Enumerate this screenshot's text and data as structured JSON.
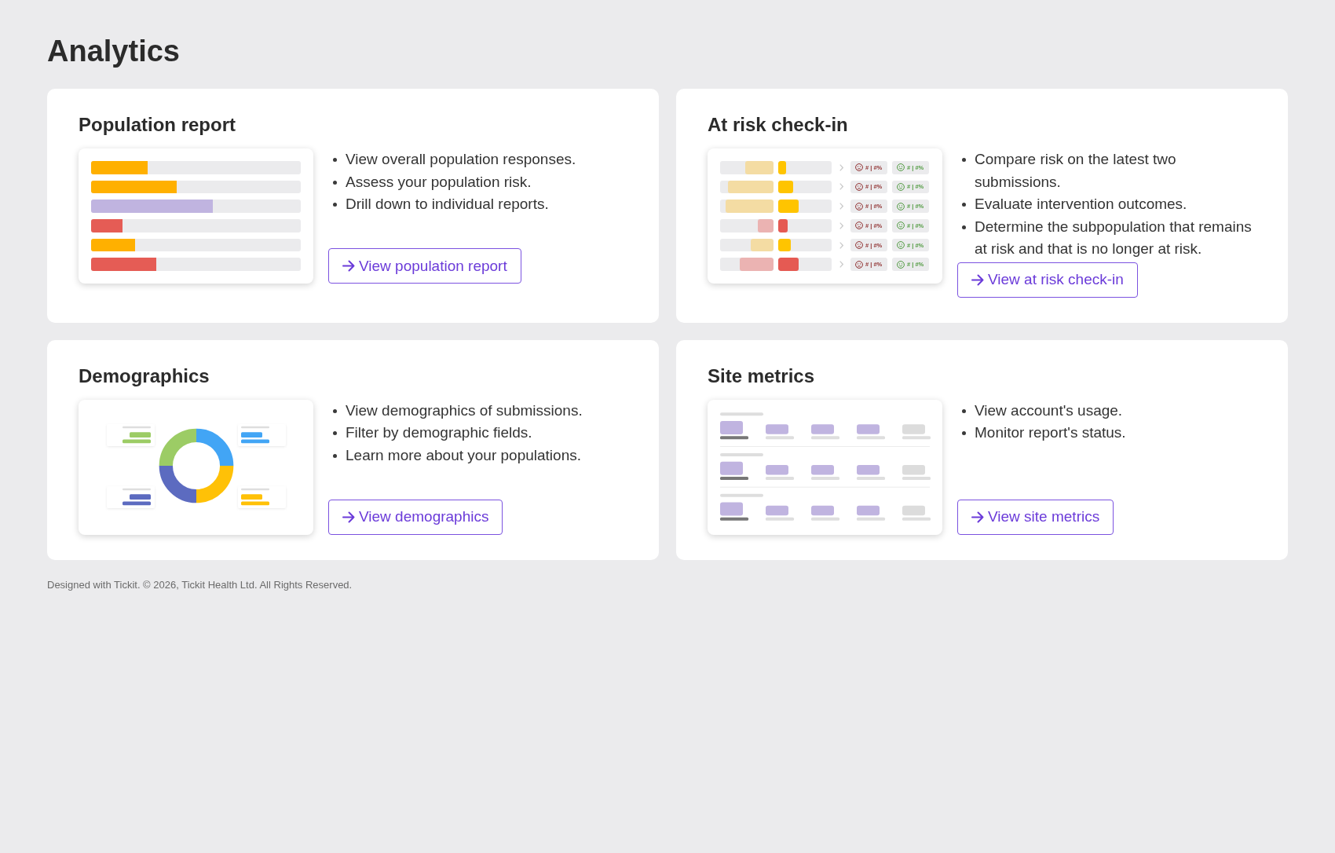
{
  "page_title": "Analytics",
  "cards": [
    {
      "title": "Population report",
      "preview": {
        "kind": "bars",
        "bars": [
          {
            "level": 0.27,
            "color": "#ffb000"
          },
          {
            "level": 0.41,
            "color": "#ffb000"
          },
          {
            "level": 0.58,
            "color": "#c0b4e0"
          },
          {
            "level": 0.15,
            "color": "#e55c55"
          },
          {
            "level": 0.21,
            "color": "#ffb000"
          },
          {
            "level": 0.31,
            "color": "#e55c55"
          }
        ]
      },
      "bullets": [
        "View overall population responses.",
        "Assess your population risk.",
        "Drill down to individual reports."
      ],
      "button": {
        "label": "View population report"
      }
    },
    {
      "title": "At risk check-in",
      "preview": {
        "kind": "risk_rows",
        "rows": [
          {
            "left_bar": {
              "level": 0.53,
              "color": "#f4dca3"
            },
            "right_bar": {
              "level": 0.14,
              "color": "#ffc400"
            },
            "tags": [
              {
                "kind": "sad",
                "text": "# | #%"
              },
              {
                "kind": "happy",
                "text": "# | #%"
              }
            ]
          },
          {
            "left_bar": {
              "level": 0.85,
              "color": "#f4dca3"
            },
            "right_bar": {
              "level": 0.28,
              "color": "#ffc400"
            },
            "tags": [
              {
                "kind": "sad",
                "text": "# | #%"
              },
              {
                "kind": "happy",
                "text": "# | #%"
              }
            ]
          },
          {
            "left_bar": {
              "level": 0.9,
              "color": "#f4dca3"
            },
            "right_bar": {
              "level": 0.38,
              "color": "#ffc400"
            },
            "tags": [
              {
                "kind": "sad",
                "text": "# | #%"
              },
              {
                "kind": "happy",
                "text": "# | #%"
              }
            ]
          },
          {
            "left_bar": {
              "level": 0.3,
              "color": "#ebb3b2"
            },
            "right_bar": {
              "level": 0.18,
              "color": "#e55a53"
            },
            "tags": [
              {
                "kind": "sad",
                "text": "# | #%"
              },
              {
                "kind": "happy",
                "text": "# | #%"
              }
            ]
          },
          {
            "left_bar": {
              "level": 0.42,
              "color": "#f4dca3"
            },
            "right_bar": {
              "level": 0.24,
              "color": "#ffc400"
            },
            "tags": [
              {
                "kind": "sad",
                "text": "# | #%"
              },
              {
                "kind": "happy",
                "text": "# | #%"
              }
            ]
          },
          {
            "left_bar": {
              "level": 0.63,
              "color": "#ebb3b2"
            },
            "right_bar": {
              "level": 0.38,
              "color": "#e55a53"
            },
            "tags": [
              {
                "kind": "sad",
                "text": "# | #%"
              },
              {
                "kind": "happy",
                "text": "# | #%"
              }
            ]
          }
        ]
      },
      "bullets": [
        "Compare risk on the latest two submissions.",
        "Evaluate intervention outcomes.",
        "Determine the subpopulation that remains at risk and that is no longer at risk."
      ],
      "button": {
        "label": "View at risk check-in"
      }
    },
    {
      "title": "Demographics",
      "preview": {
        "kind": "donut"
      },
      "bullets": [
        "View demographics of submissions.",
        "Filter by demographic fields.",
        "Learn more about your populations."
      ],
      "button": {
        "label": "View demographics"
      }
    },
    {
      "title": "Site metrics",
      "preview": {
        "kind": "table"
      },
      "bullets": [
        "View account's usage.",
        "Monitor report's status."
      ],
      "button": {
        "label": "View site metrics"
      }
    }
  ],
  "footer": "Designed with Tickit. © 2026, Tickit Health Ltd. All Rights Reserved."
}
